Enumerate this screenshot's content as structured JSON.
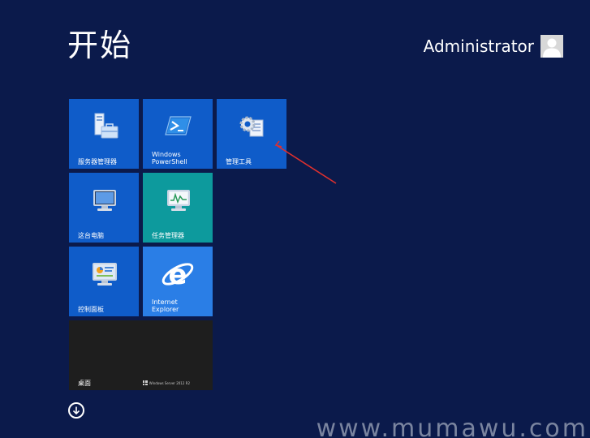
{
  "header": {
    "title": "开始",
    "user_name": "Administrator"
  },
  "tiles": [
    {
      "label": "服务器管理器",
      "icon": "server-manager-icon"
    },
    {
      "label": "Windows\nPowerShell",
      "icon": "powershell-icon"
    },
    {
      "label": "管理工具",
      "icon": "admin-tools-icon"
    },
    {
      "label": "这台电脑",
      "icon": "this-pc-icon"
    },
    {
      "label": "任务管理器",
      "icon": "task-manager-icon"
    },
    {
      "label": "控制面板",
      "icon": "control-panel-icon"
    },
    {
      "label": "Internet\nExplorer",
      "icon": "internet-explorer-icon"
    },
    {
      "label": "桌面",
      "icon": "desktop-icon",
      "badge": "Windows Server 2012 R2"
    }
  ],
  "colors": {
    "background": "#0b1a4b",
    "tile_blue": "#0f5cc9",
    "tile_teal": "#0d9a9d",
    "tile_ie": "#2a7ee6",
    "tile_desktop": "#1e1e1e",
    "annotation_arrow": "#e0302e"
  },
  "watermark": "www.mumawu.com"
}
